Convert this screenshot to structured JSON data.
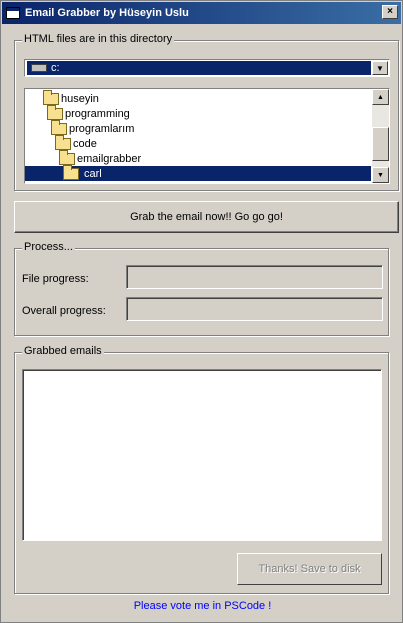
{
  "window": {
    "title": "Email Grabber by Hüseyin Uslu",
    "close_label": "×"
  },
  "directory_group": {
    "legend": "HTML files are in this directory",
    "drive": "c:",
    "folders": [
      {
        "name": "huseyin",
        "depth": 0,
        "selected": false
      },
      {
        "name": "programming",
        "depth": 1,
        "selected": false
      },
      {
        "name": "programlarım",
        "depth": 2,
        "selected": false
      },
      {
        "name": "code",
        "depth": 3,
        "selected": false
      },
      {
        "name": "emailgrabber",
        "depth": 4,
        "selected": false
      },
      {
        "name": "carl",
        "depth": 5,
        "selected": true
      }
    ]
  },
  "grab_button": {
    "label": "Grab the email now!! Go go go!"
  },
  "process_group": {
    "legend": "Process...",
    "file_label": "File progress:",
    "overall_label": "Overall progress:",
    "file_progress": 0,
    "overall_progress": 0
  },
  "emails_group": {
    "legend": "Grabbed emails",
    "save_label": "Thanks! Save to disk",
    "save_enabled": false
  },
  "footer": {
    "vote_text": "Please vote me in PSCode !",
    "link_color": "#0000ff"
  },
  "colors": {
    "selection": "#0a246a",
    "face": "#d4d0c8"
  }
}
